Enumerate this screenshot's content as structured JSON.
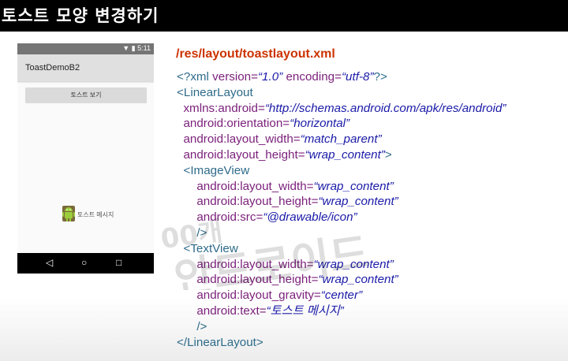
{
  "header": {
    "title": "토스트 모양 변경하기"
  },
  "phone": {
    "status_time": "5:11",
    "app_title": "ToastDemoB2",
    "button_label": "토스트 보기",
    "toast_text": "토스트 메시지",
    "nav": {
      "back": "◁",
      "home": "○",
      "recent": "□"
    }
  },
  "slide": {
    "file_path": "/res/layout/toastlayout.xml",
    "code": {
      "xml_open": "<?xml ",
      "xml_version_attr": "version=",
      "xml_version_val": "“1.0”",
      "xml_enc_attr": "encoding=",
      "xml_enc_val": "“utf-8”",
      "xml_close": "?>",
      "linear_open": "<LinearLayout",
      "xmlns_attr": "xmlns:android=",
      "xmlns_val": "“http://schemas.android.com/apk/res/android”",
      "orientation_attr": "android:orientation=",
      "orientation_val": "“horizontal”",
      "ll_width_attr": "android:layout_width=",
      "ll_width_val": "“match_parent”",
      "ll_height_attr": "android:layout_height=",
      "ll_height_val": "“wrap_content”",
      "ll_gt": ">",
      "image_open": "<ImageView",
      "iv_width_attr": "android:layout_width=",
      "iv_width_val": "“wrap_content”",
      "iv_height_attr": "android:layout_height=",
      "iv_height_val": "“wrap_content”",
      "iv_src_attr": "android:src=",
      "iv_src_val": "“@drawable/icon”",
      "self_close": "/>",
      "text_open": "<TextView",
      "tv_width_attr": "android:layout_width=",
      "tv_width_val": "“wrap_content”",
      "tv_height_attr": "android:layout_height=",
      "tv_height_val": "“wrap_content”",
      "tv_gravity_attr": "android:layout_gravity=",
      "tv_gravity_val": "“center”",
      "tv_text_attr": "android:text=",
      "tv_text_val": "“토스트 메시지”",
      "linear_close": "</LinearLayout>"
    }
  },
  "watermark": {
    "line1": "00개",
    "line2": "안드로이드"
  },
  "colors": {
    "path": "#cc3300",
    "tag": "#2e6b8a",
    "attr": "#7a1f7a",
    "value": "#1a1aa8"
  }
}
